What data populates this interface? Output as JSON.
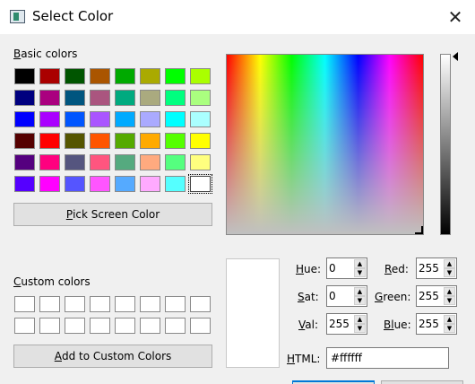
{
  "window": {
    "title": "Select Color",
    "close_glyph": "✕"
  },
  "basic_colors": {
    "label_first": "B",
    "label_rest": "asic colors",
    "swatches": [
      "#000000",
      "#aa0000",
      "#005500",
      "#aa5500",
      "#00aa00",
      "#aaaa00",
      "#00ff00",
      "#aaff00",
      "#00007f",
      "#aa007f",
      "#00557f",
      "#aa557f",
      "#00aa7f",
      "#aaaa7f",
      "#00ff7f",
      "#aaff7f",
      "#0000ff",
      "#aa00ff",
      "#0055ff",
      "#aa55ff",
      "#00aaff",
      "#aaaaff",
      "#00ffff",
      "#aaffff",
      "#550000",
      "#ff0000",
      "#555500",
      "#ff5500",
      "#55aa00",
      "#ffaa00",
      "#55ff00",
      "#ffff00",
      "#55007f",
      "#ff007f",
      "#55557f",
      "#ff557f",
      "#55aa7f",
      "#ffaa7f",
      "#55ff7f",
      "#ffff7f",
      "#5500ff",
      "#ff00ff",
      "#5555ff",
      "#ff55ff",
      "#55aaff",
      "#ffaaff",
      "#55ffff",
      "#ffffff"
    ],
    "selected_index": 47
  },
  "pick_screen_button": {
    "label_first": "P",
    "label_rest": "ick Screen Color"
  },
  "custom_colors": {
    "label_first": "C",
    "label_rest": "ustom colors",
    "count": 16
  },
  "add_custom_button": {
    "label_first": "A",
    "label_rest": "dd to Custom Colors"
  },
  "fields": {
    "hue": {
      "label_first": "H",
      "label_rest": "ue:",
      "value": "0"
    },
    "sat": {
      "label_first": "S",
      "label_rest": "at:",
      "value": "0"
    },
    "val": {
      "label_first": "V",
      "label_rest": "al:",
      "value": "255"
    },
    "red": {
      "label_first": "R",
      "label_rest": "ed:",
      "value": "255"
    },
    "green": {
      "label_first": "G",
      "label_rest": "reen:",
      "value": "255"
    },
    "blue": {
      "label_first": "Bl",
      "label_rest": "ue:",
      "value": "255"
    }
  },
  "html_field": {
    "label_first": "H",
    "label_rest": "TML:",
    "value": "#ffffff"
  },
  "current_color": "#ffffff"
}
